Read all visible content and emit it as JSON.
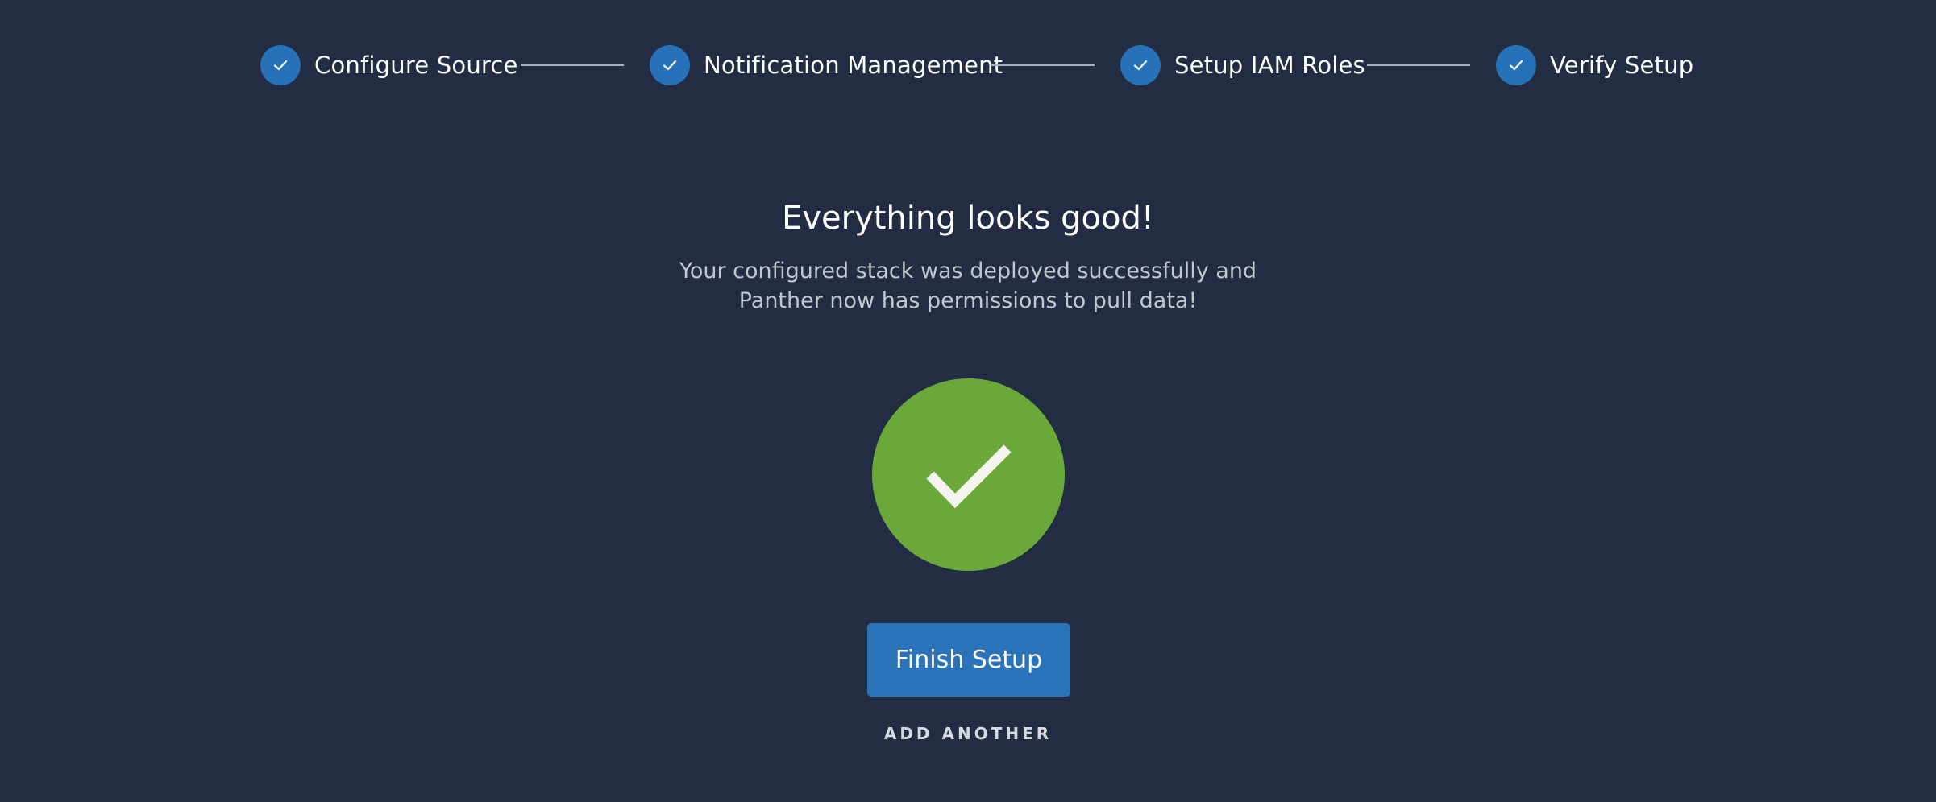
{
  "stepper": {
    "steps": [
      {
        "label": "Configure Source",
        "status": "complete",
        "icon": "check-icon"
      },
      {
        "label": "Notification Management",
        "status": "complete",
        "icon": "check-icon"
      },
      {
        "label": "Setup IAM Roles",
        "status": "complete",
        "icon": "check-icon"
      },
      {
        "label": "Verify Setup",
        "status": "complete",
        "icon": "check-icon"
      }
    ]
  },
  "result": {
    "title": "Everything looks good!",
    "message_line1": "Your configured stack was deployed successfully and",
    "message_line2": "Panther now has permissions to pull data!",
    "status_icon": "success-check-icon"
  },
  "actions": {
    "finish_label": "Finish Setup",
    "add_another_label": "ADD ANOTHER"
  },
  "colors": {
    "background": "#222d44",
    "step_accent": "#2671b7",
    "success": "#6aa83a",
    "primary_button": "#2a73b8"
  }
}
